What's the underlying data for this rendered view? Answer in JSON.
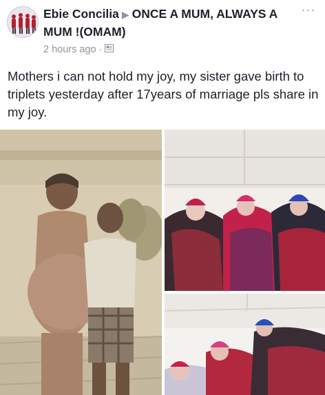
{
  "post": {
    "author": "Ebie Concilia",
    "group": "ONCE A MUM, ALWAYS A MUM !(OMAM)",
    "timestamp": "2 hours ago",
    "separator": "·",
    "text": "Mothers i can not hold my joy, my sister gave birth to triplets  yesterday  after 17years of marriage  pls share in my joy."
  },
  "icons": {
    "more": "more-options-icon",
    "privacy": "photo-icon",
    "arrow": "triangle-right-icon"
  },
  "colors": {
    "text": "#1d2129",
    "meta": "#90949c"
  }
}
